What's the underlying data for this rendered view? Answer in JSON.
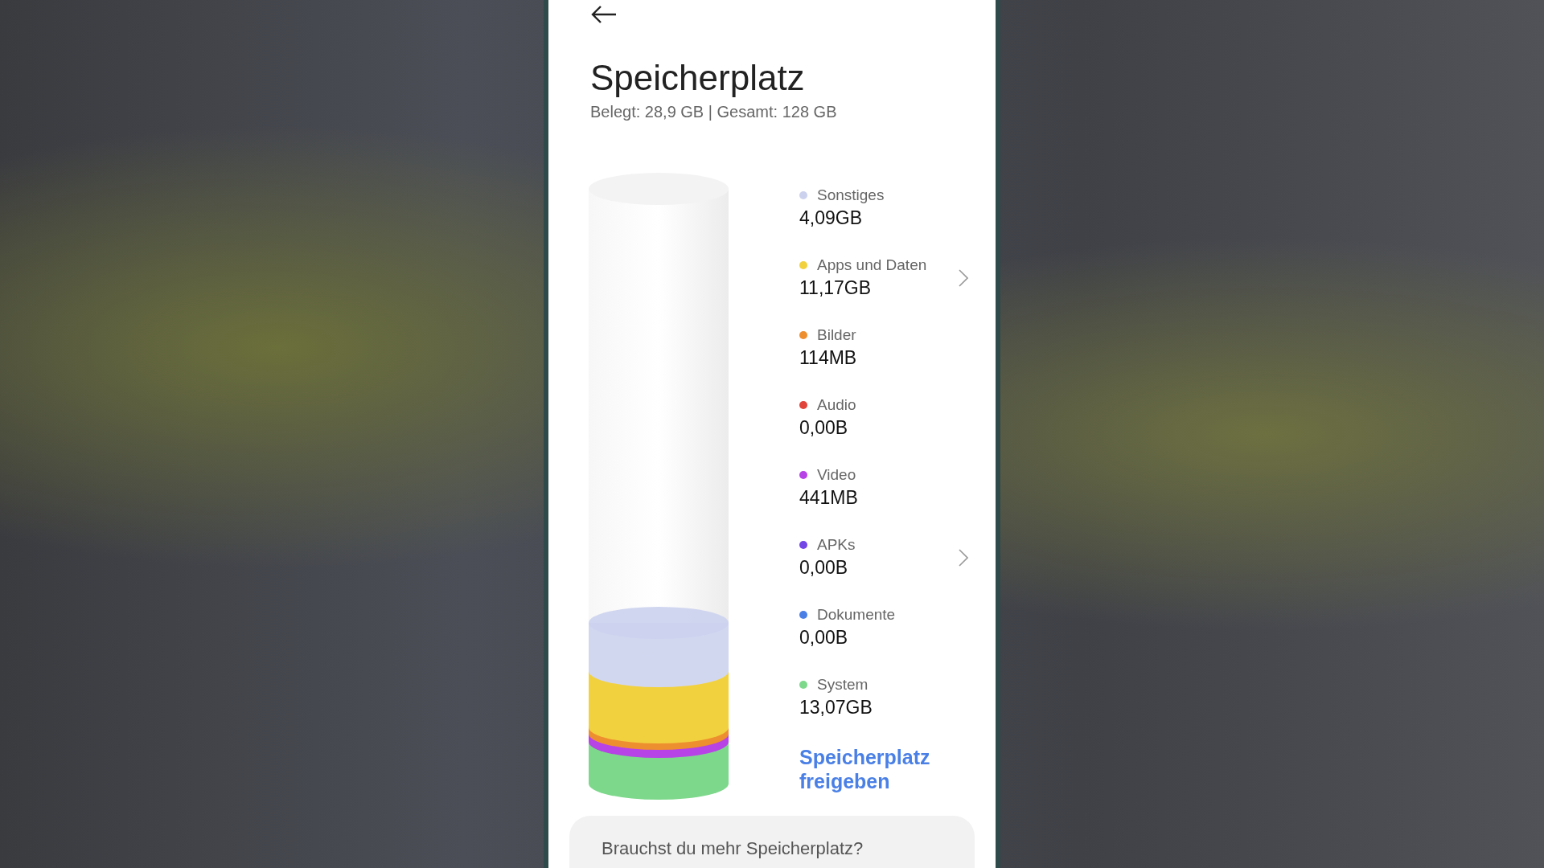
{
  "header": {
    "title": "Speicherplatz",
    "summary": "Belegt: 28,9 GB | Gesamt: 128 GB"
  },
  "categories": [
    {
      "label": "Sonstiges",
      "value": "4,09GB",
      "color": "#ccd2ee",
      "chevron": false
    },
    {
      "label": "Apps und Daten",
      "value": "11,17GB",
      "color": "#f2d13f",
      "chevron": true
    },
    {
      "label": "Bilder",
      "value": "114MB",
      "color": "#ee8f2f",
      "chevron": false
    },
    {
      "label": "Audio",
      "value": "0,00B",
      "color": "#e0443a",
      "chevron": false
    },
    {
      "label": "Video",
      "value": "441MB",
      "color": "#b742e6",
      "chevron": false
    },
    {
      "label": "APKs",
      "value": "0,00B",
      "color": "#7346e6",
      "chevron": true
    },
    {
      "label": "Dokumente",
      "value": "0,00B",
      "color": "#4a7fe6",
      "chevron": false
    },
    {
      "label": "System",
      "value": "13,07GB",
      "color": "#7ed88c",
      "chevron": false
    }
  ],
  "free_up_link": "Speicherplatz freigeben",
  "promo_card": {
    "text": "Brauchst du mehr Speicherplatz?"
  }
}
